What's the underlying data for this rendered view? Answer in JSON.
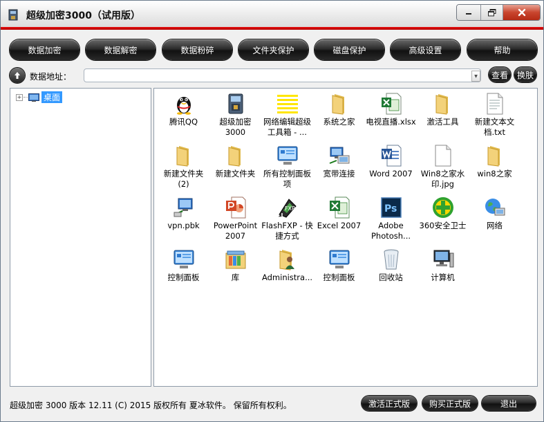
{
  "window": {
    "title": "超级加密3000（试用版）"
  },
  "toolbar": {
    "buttons": [
      "数据加密",
      "数据解密",
      "数据粉碎",
      "文件夹保护",
      "磁盘保护",
      "高级设置",
      "帮助"
    ]
  },
  "address": {
    "label": "数据地址：",
    "value": "",
    "view_label": "查看",
    "skin_label": "换肤"
  },
  "tree": {
    "root_label": "桌面",
    "expander": "+"
  },
  "files": [
    {
      "name": "腾讯QQ",
      "icon": "qq-penguin-icon"
    },
    {
      "name": "超级加密3000",
      "icon": "app-box-icon"
    },
    {
      "name": "网络编辑超级工具箱 - ...",
      "icon": "notepad-lines-icon"
    },
    {
      "name": "系统之家",
      "icon": "folder-icon"
    },
    {
      "name": "电视直播.xlsx",
      "icon": "excel-file-icon"
    },
    {
      "name": "激活工具",
      "icon": "folder-icon"
    },
    {
      "name": "新建文本文档.txt",
      "icon": "text-file-icon"
    },
    {
      "name": "新建文件夹 (2)",
      "icon": "folder-icon"
    },
    {
      "name": "新建文件夹",
      "icon": "folder-icon"
    },
    {
      "name": "所有控制面板项",
      "icon": "control-panel-icon"
    },
    {
      "name": "宽带连接",
      "icon": "network-connection-icon"
    },
    {
      "name": "Word 2007",
      "icon": "word-icon"
    },
    {
      "name": "Win8之家水印.jpg",
      "icon": "image-file-icon"
    },
    {
      "name": "win8之家",
      "icon": "folder-icon"
    },
    {
      "name": "vpn.pbk",
      "icon": "vpn-icon"
    },
    {
      "name": "PowerPoint 2007",
      "icon": "powerpoint-icon"
    },
    {
      "name": "FlashFXP - 快捷方式",
      "icon": "flashfxp-icon"
    },
    {
      "name": "Excel 2007",
      "icon": "excel-icon"
    },
    {
      "name": "Adobe Photosh...",
      "icon": "photoshop-icon"
    },
    {
      "name": "360安全卫士",
      "icon": "security-360-icon"
    },
    {
      "name": "网络",
      "icon": "network-globe-icon"
    },
    {
      "name": "控制面板",
      "icon": "control-panel-icon"
    },
    {
      "name": "库",
      "icon": "library-icon"
    },
    {
      "name": "Administra...",
      "icon": "user-folder-icon"
    },
    {
      "name": "控制面板",
      "icon": "control-panel-icon"
    },
    {
      "name": "回收站",
      "icon": "recycle-bin-icon"
    },
    {
      "name": "计算机",
      "icon": "computer-icon"
    }
  ],
  "status": {
    "text": "超级加密 3000  版本 12.11  (C)  2015 版权所有 夏冰软件。 保留所有权利。",
    "activate_label": "激活正式版",
    "buy_label": "购买正式版",
    "exit_label": "退出"
  },
  "colors": {
    "accent_red": "#d40000",
    "selection_blue": "#3399ff",
    "button_dark": "#222222"
  }
}
